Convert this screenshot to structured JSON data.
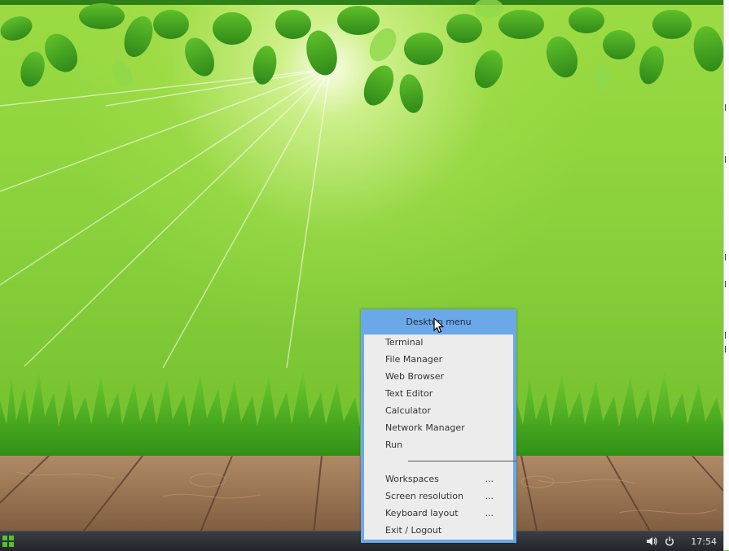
{
  "desktop": {
    "taskbar": {
      "start_icon": "grid-start-icon",
      "tray": [
        {
          "name": "volume-icon"
        },
        {
          "name": "power-icon"
        }
      ],
      "clock": "17:54"
    },
    "menu": {
      "title": "Desktop menu",
      "items": [
        {
          "label": "Terminal",
          "more": ""
        },
        {
          "label": "File Manager",
          "more": ""
        },
        {
          "label": "Web Browser",
          "more": ""
        },
        {
          "label": "Text Editor",
          "more": ""
        },
        {
          "label": "Calculator",
          "more": ""
        },
        {
          "label": "Network Manager",
          "more": ""
        },
        {
          "label": "Run",
          "more": ""
        },
        {
          "label": "Workspaces",
          "more": "..."
        },
        {
          "label": "Screen resolution",
          "more": "..."
        },
        {
          "label": "Keyboard layout",
          "more": "..."
        },
        {
          "label": "Exit / Logout",
          "more": ""
        }
      ]
    },
    "colors": {
      "menu_title_bg": "#6aa8ea",
      "menu_body_bg": "#ececec",
      "taskbar_bg": "#2b2f34",
      "start_green": "#55c22a"
    }
  }
}
